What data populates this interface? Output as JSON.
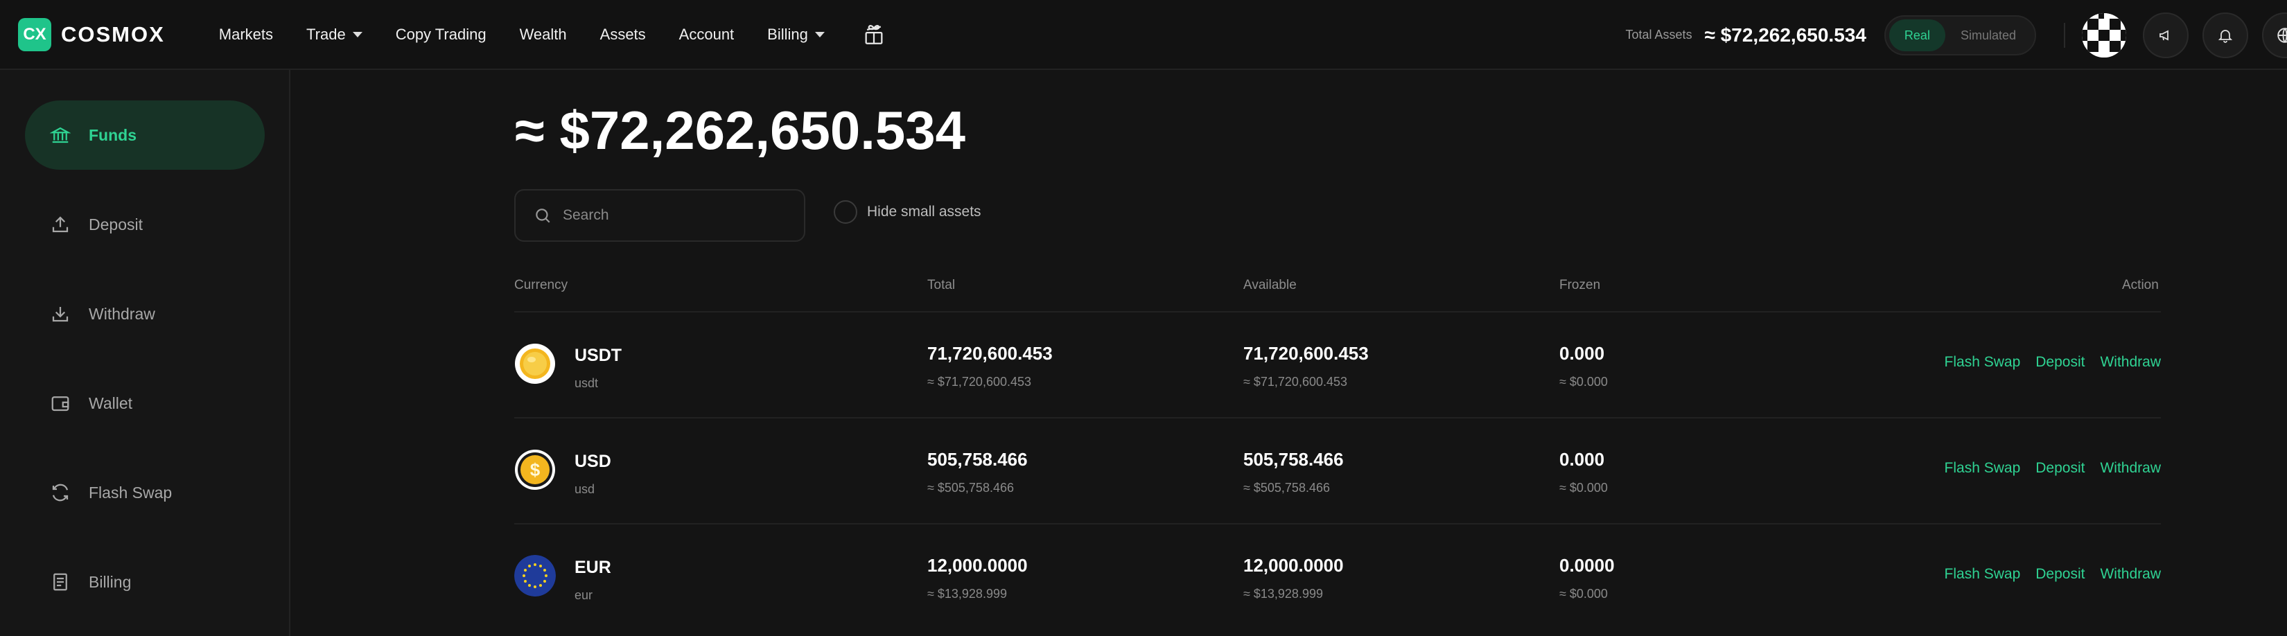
{
  "brand": {
    "mark": "CX",
    "name": "COSMOX",
    "accent": "#1fc48a"
  },
  "nav": {
    "markets": "Markets",
    "trade": "Trade",
    "copy_trading": "Copy Trading",
    "wealth": "Wealth",
    "assets": "Assets",
    "account": "Account",
    "billing": "Billing"
  },
  "header": {
    "total_label": "Total Assets",
    "total_value": "≈ $72,262,650.534",
    "mode_real": "Real",
    "mode_simulated": "Simulated",
    "active_mode": "Real"
  },
  "sidebar": {
    "items": [
      {
        "label": "Funds",
        "icon": "bank-icon",
        "active": true
      },
      {
        "label": "Deposit",
        "icon": "upload-icon",
        "active": false
      },
      {
        "label": "Withdraw",
        "icon": "download-icon",
        "active": false
      },
      {
        "label": "Wallet",
        "icon": "wallet-icon",
        "active": false
      },
      {
        "label": "Flash Swap",
        "icon": "swap-icon",
        "active": false
      },
      {
        "label": "Billing",
        "icon": "document-icon",
        "active": false
      }
    ]
  },
  "main": {
    "total": "≈ $72,262,650.534",
    "search_placeholder": "Search",
    "hide_small_label": "Hide small assets",
    "hide_small_checked": false,
    "columns": {
      "currency": "Currency",
      "total": "Total",
      "available": "Available",
      "frozen": "Frozen",
      "action": "Action"
    },
    "rows": [
      {
        "name": "USDT",
        "code": "usdt",
        "total": "71,720,600.453",
        "total_usd": "≈ $71,720,600.453",
        "available": "71,720,600.453",
        "available_usd": "≈ $71,720,600.453",
        "frozen": "0.000",
        "frozen_usd": "≈ $0.000"
      },
      {
        "name": "USD",
        "code": "usd",
        "total": "505,758.466",
        "total_usd": "≈ $505,758.466",
        "available": "505,758.466",
        "available_usd": "≈ $505,758.466",
        "frozen": "0.000",
        "frozen_usd": "≈ $0.000"
      },
      {
        "name": "EUR",
        "code": "eur",
        "total": "12,000.0000",
        "total_usd": "≈ $13,928.999",
        "available": "12,000.0000",
        "available_usd": "≈ $13,928.999",
        "frozen": "0.0000",
        "frozen_usd": "≈ $0.000"
      }
    ],
    "actions": {
      "flash_swap": "Flash Swap",
      "deposit": "Deposit",
      "withdraw": "Withdraw"
    }
  }
}
